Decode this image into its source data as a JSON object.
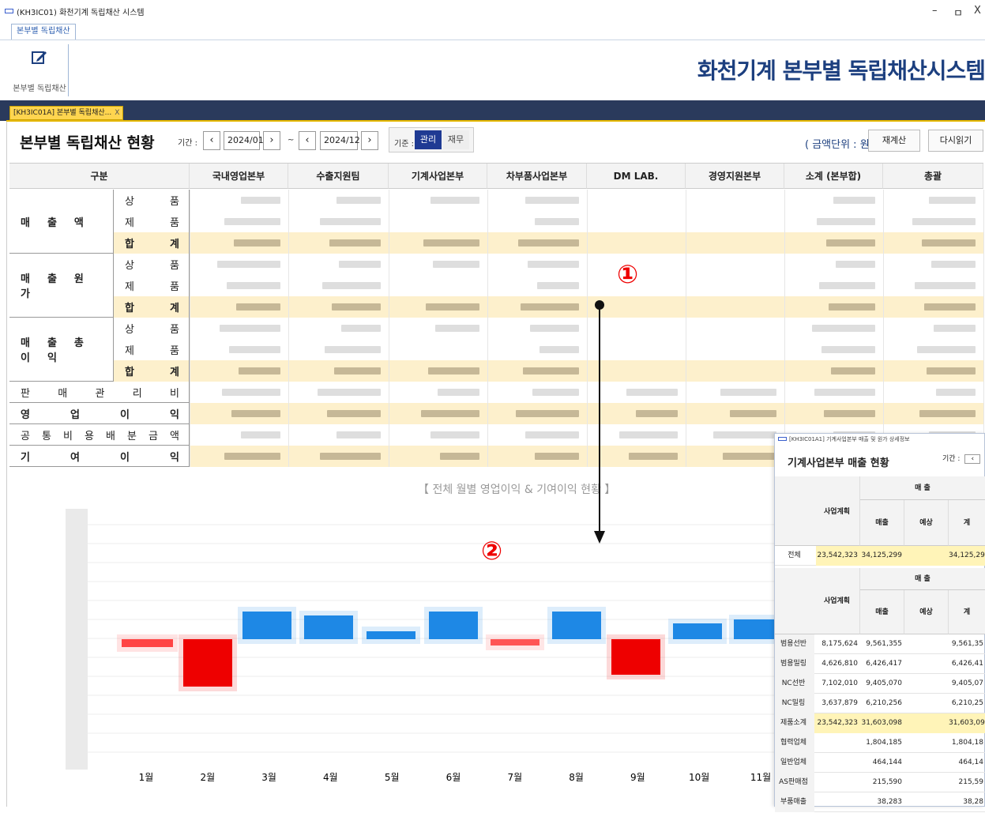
{
  "window": {
    "title": "(KH3IC01) 화천기계 독립채산 시스템",
    "controls": [
      "–",
      "ㅁ",
      "X"
    ]
  },
  "ribbon": {
    "tab": "본부별 독립채산",
    "button_label": "본부별 독립채산"
  },
  "app_title": "화천기계 본부별 독립채산시스템",
  "doc_tab": {
    "label": "[KH3IC01A] 본부별 독립채산...",
    "close": "X"
  },
  "page": {
    "title": "본부별 독립채산 현황",
    "period_label": "기간 :",
    "period_from": "2024/01",
    "period_to": "2024/12",
    "tilde": "~",
    "basis_label": "기준 :",
    "basis_options": [
      "관리",
      "재무"
    ],
    "basis_selected": "관리",
    "unit": "( 금액단위 : 원 )",
    "btn_recalc": "재계산",
    "btn_reload": "다시읽기"
  },
  "grid": {
    "columns": [
      "구분",
      "국내영업본부",
      "수출지원팀",
      "기계사업본부",
      "차부품사업본부",
      "DM LAB.",
      "경영지원본부",
      "소계 (본부합)",
      "총괄"
    ],
    "groups": [
      {
        "name": "매 출 액",
        "subs": [
          "상 품",
          "제 품",
          "합 계"
        ]
      },
      {
        "name": "매 출 원 가",
        "subs": [
          "상 품",
          "제 품",
          "합 계"
        ]
      },
      {
        "name": "매 출 총 이 익",
        "subs": [
          "상 품",
          "제 품",
          "합 계"
        ]
      }
    ],
    "single_rows": [
      "판 매 관 리 비",
      "영 업 이 익",
      "공 통 비 용 배 분 금 액",
      "기 여 이 익"
    ]
  },
  "chart": {
    "title": "【 전체 월별 영업이익 & 기여이익 현황 】",
    "months": [
      "1월",
      "2월",
      "3월",
      "4월",
      "5월",
      "6월",
      "7월",
      "8월",
      "9월",
      "10월",
      "11월"
    ]
  },
  "annotations": {
    "one": "①",
    "two": "②"
  },
  "overlay": {
    "title_bar": "[KH3IC01A1] 기계사업본부 매출 및 원가 상세정보",
    "title": "기계사업본부 매출 현황",
    "period_label": "기간 :",
    "header_group": "매 출",
    "headers": [
      "사업계획",
      "매출",
      "예상",
      "계"
    ],
    "total_row": {
      "label": "전체",
      "plan": "23,542,323",
      "sales": "34,125,299",
      "expected": "",
      "sum": "34,125,29"
    },
    "rows": [
      {
        "label": "범용선반",
        "plan": "8,175,624",
        "sales": "9,561,355",
        "expected": "",
        "sum": "9,561,35"
      },
      {
        "label": "범용밀링",
        "plan": "4,626,810",
        "sales": "6,426,417",
        "expected": "",
        "sum": "6,426,41"
      },
      {
        "label": "NC선반",
        "plan": "7,102,010",
        "sales": "9,405,070",
        "expected": "",
        "sum": "9,405,07"
      },
      {
        "label": "NC밀링",
        "plan": "3,637,879",
        "sales": "6,210,256",
        "expected": "",
        "sum": "6,210,25"
      },
      {
        "label": "제품소계",
        "plan": "23,542,323",
        "sales": "31,603,098",
        "expected": "",
        "sum": "31,603,09"
      },
      {
        "label": "협력업체",
        "plan": "",
        "sales": "1,804,185",
        "expected": "",
        "sum": "1,804,18"
      },
      {
        "label": "일반업체",
        "plan": "",
        "sales": "464,144",
        "expected": "",
        "sum": "464,14"
      },
      {
        "label": "AS판매점",
        "plan": "",
        "sales": "215,590",
        "expected": "",
        "sum": "215,59"
      },
      {
        "label": "부품매출",
        "plan": "",
        "sales": "38,283",
        "expected": "",
        "sum": "38,28"
      }
    ]
  },
  "colors": {
    "navy": "#2a3a5c",
    "tab_yellow": "#ffd54f",
    "sum_row": "#fdf0cc",
    "bar_blue": "#1e88e5",
    "bar_red": "#e00000"
  }
}
